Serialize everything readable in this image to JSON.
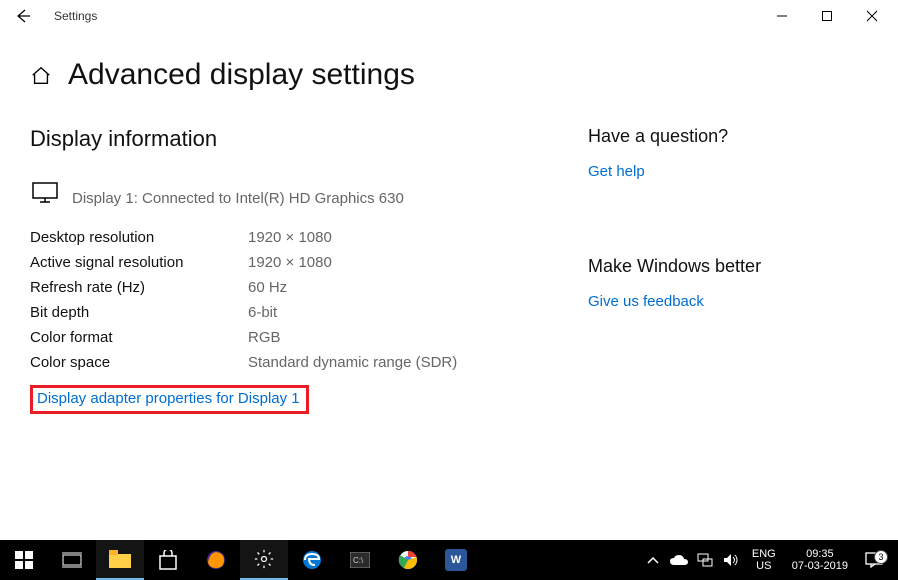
{
  "window": {
    "title": "Settings",
    "page_title": "Advanced display settings"
  },
  "display_info": {
    "heading": "Display information",
    "connected_text": "Display 1: Connected to Intel(R) HD Graphics 630",
    "rows": [
      {
        "label": "Desktop resolution",
        "value": "1920 × 1080"
      },
      {
        "label": "Active signal resolution",
        "value": "1920 × 1080"
      },
      {
        "label": "Refresh rate (Hz)",
        "value": "60 Hz"
      },
      {
        "label": "Bit depth",
        "value": "6-bit"
      },
      {
        "label": "Color format",
        "value": "RGB"
      },
      {
        "label": "Color space",
        "value": "Standard dynamic range (SDR)"
      }
    ],
    "adapter_link": "Display adapter properties for Display 1"
  },
  "sidebar": {
    "question_heading": "Have a question?",
    "help_link": "Get help",
    "feedback_heading": "Make Windows better",
    "feedback_link": "Give us feedback"
  },
  "taskbar": {
    "lang1": "ENG",
    "lang2": "US",
    "time": "09:35",
    "date": "07-03-2019",
    "notif_count": "3"
  }
}
